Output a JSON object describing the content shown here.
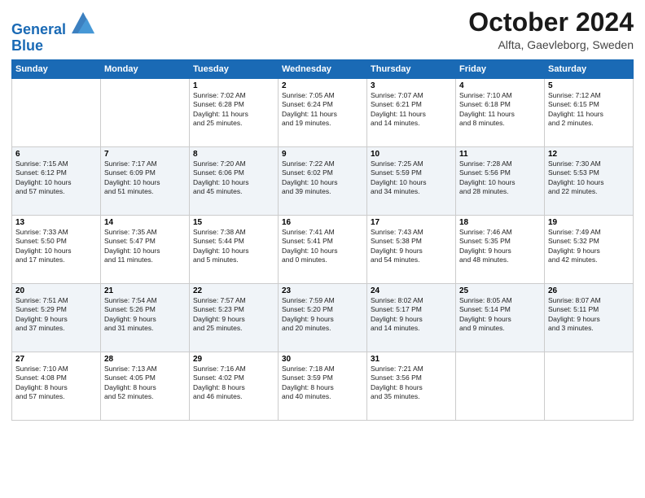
{
  "header": {
    "logo_line1": "General",
    "logo_line2": "Blue",
    "month": "October 2024",
    "location": "Alfta, Gaevleborg, Sweden"
  },
  "weekdays": [
    "Sunday",
    "Monday",
    "Tuesday",
    "Wednesday",
    "Thursday",
    "Friday",
    "Saturday"
  ],
  "weeks": [
    [
      {
        "day": "",
        "info": ""
      },
      {
        "day": "",
        "info": ""
      },
      {
        "day": "1",
        "info": "Sunrise: 7:02 AM\nSunset: 6:28 PM\nDaylight: 11 hours\nand 25 minutes."
      },
      {
        "day": "2",
        "info": "Sunrise: 7:05 AM\nSunset: 6:24 PM\nDaylight: 11 hours\nand 19 minutes."
      },
      {
        "day": "3",
        "info": "Sunrise: 7:07 AM\nSunset: 6:21 PM\nDaylight: 11 hours\nand 14 minutes."
      },
      {
        "day": "4",
        "info": "Sunrise: 7:10 AM\nSunset: 6:18 PM\nDaylight: 11 hours\nand 8 minutes."
      },
      {
        "day": "5",
        "info": "Sunrise: 7:12 AM\nSunset: 6:15 PM\nDaylight: 11 hours\nand 2 minutes."
      }
    ],
    [
      {
        "day": "6",
        "info": "Sunrise: 7:15 AM\nSunset: 6:12 PM\nDaylight: 10 hours\nand 57 minutes."
      },
      {
        "day": "7",
        "info": "Sunrise: 7:17 AM\nSunset: 6:09 PM\nDaylight: 10 hours\nand 51 minutes."
      },
      {
        "day": "8",
        "info": "Sunrise: 7:20 AM\nSunset: 6:06 PM\nDaylight: 10 hours\nand 45 minutes."
      },
      {
        "day": "9",
        "info": "Sunrise: 7:22 AM\nSunset: 6:02 PM\nDaylight: 10 hours\nand 39 minutes."
      },
      {
        "day": "10",
        "info": "Sunrise: 7:25 AM\nSunset: 5:59 PM\nDaylight: 10 hours\nand 34 minutes."
      },
      {
        "day": "11",
        "info": "Sunrise: 7:28 AM\nSunset: 5:56 PM\nDaylight: 10 hours\nand 28 minutes."
      },
      {
        "day": "12",
        "info": "Sunrise: 7:30 AM\nSunset: 5:53 PM\nDaylight: 10 hours\nand 22 minutes."
      }
    ],
    [
      {
        "day": "13",
        "info": "Sunrise: 7:33 AM\nSunset: 5:50 PM\nDaylight: 10 hours\nand 17 minutes."
      },
      {
        "day": "14",
        "info": "Sunrise: 7:35 AM\nSunset: 5:47 PM\nDaylight: 10 hours\nand 11 minutes."
      },
      {
        "day": "15",
        "info": "Sunrise: 7:38 AM\nSunset: 5:44 PM\nDaylight: 10 hours\nand 5 minutes."
      },
      {
        "day": "16",
        "info": "Sunrise: 7:41 AM\nSunset: 5:41 PM\nDaylight: 10 hours\nand 0 minutes."
      },
      {
        "day": "17",
        "info": "Sunrise: 7:43 AM\nSunset: 5:38 PM\nDaylight: 9 hours\nand 54 minutes."
      },
      {
        "day": "18",
        "info": "Sunrise: 7:46 AM\nSunset: 5:35 PM\nDaylight: 9 hours\nand 48 minutes."
      },
      {
        "day": "19",
        "info": "Sunrise: 7:49 AM\nSunset: 5:32 PM\nDaylight: 9 hours\nand 42 minutes."
      }
    ],
    [
      {
        "day": "20",
        "info": "Sunrise: 7:51 AM\nSunset: 5:29 PM\nDaylight: 9 hours\nand 37 minutes."
      },
      {
        "day": "21",
        "info": "Sunrise: 7:54 AM\nSunset: 5:26 PM\nDaylight: 9 hours\nand 31 minutes."
      },
      {
        "day": "22",
        "info": "Sunrise: 7:57 AM\nSunset: 5:23 PM\nDaylight: 9 hours\nand 25 minutes."
      },
      {
        "day": "23",
        "info": "Sunrise: 7:59 AM\nSunset: 5:20 PM\nDaylight: 9 hours\nand 20 minutes."
      },
      {
        "day": "24",
        "info": "Sunrise: 8:02 AM\nSunset: 5:17 PM\nDaylight: 9 hours\nand 14 minutes."
      },
      {
        "day": "25",
        "info": "Sunrise: 8:05 AM\nSunset: 5:14 PM\nDaylight: 9 hours\nand 9 minutes."
      },
      {
        "day": "26",
        "info": "Sunrise: 8:07 AM\nSunset: 5:11 PM\nDaylight: 9 hours\nand 3 minutes."
      }
    ],
    [
      {
        "day": "27",
        "info": "Sunrise: 7:10 AM\nSunset: 4:08 PM\nDaylight: 8 hours\nand 57 minutes."
      },
      {
        "day": "28",
        "info": "Sunrise: 7:13 AM\nSunset: 4:05 PM\nDaylight: 8 hours\nand 52 minutes."
      },
      {
        "day": "29",
        "info": "Sunrise: 7:16 AM\nSunset: 4:02 PM\nDaylight: 8 hours\nand 46 minutes."
      },
      {
        "day": "30",
        "info": "Sunrise: 7:18 AM\nSunset: 3:59 PM\nDaylight: 8 hours\nand 40 minutes."
      },
      {
        "day": "31",
        "info": "Sunrise: 7:21 AM\nSunset: 3:56 PM\nDaylight: 8 hours\nand 35 minutes."
      },
      {
        "day": "",
        "info": ""
      },
      {
        "day": "",
        "info": ""
      }
    ]
  ]
}
